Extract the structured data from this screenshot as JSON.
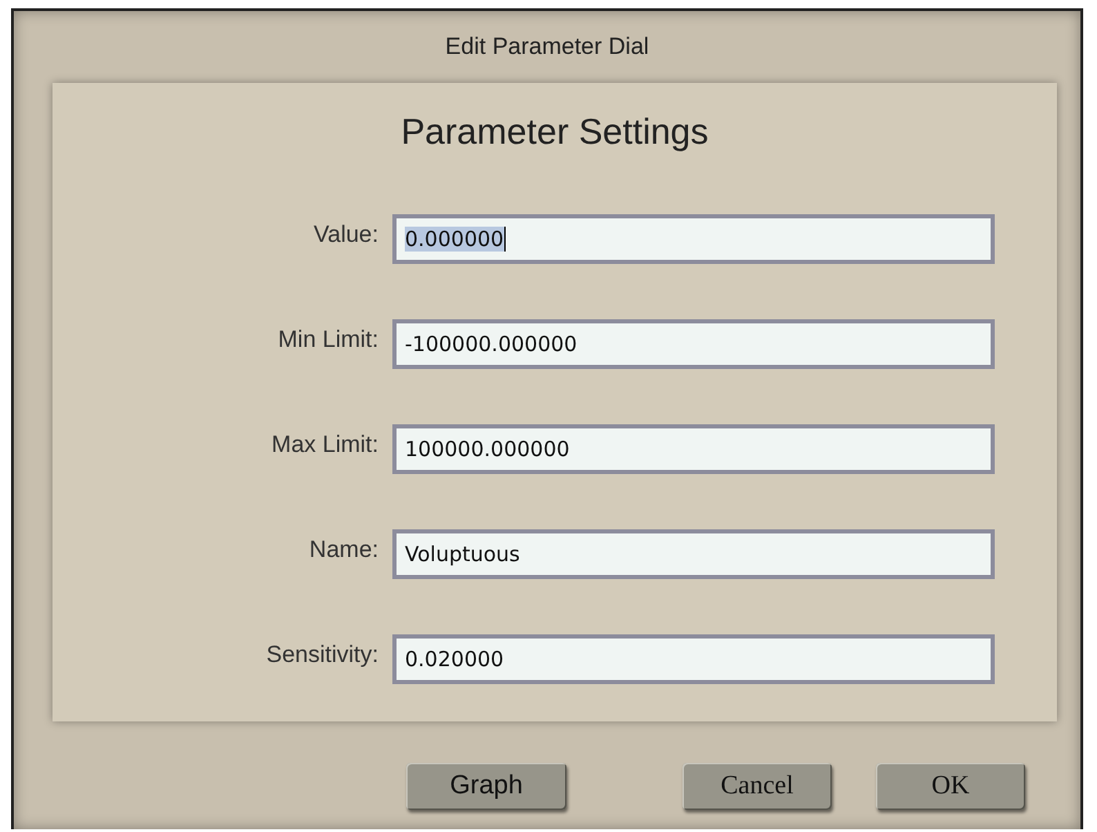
{
  "window": {
    "title": "Edit Parameter Dial"
  },
  "heading": "Parameter Settings",
  "fields": [
    {
      "label": "Value:",
      "value": "0.000000",
      "selected": true
    },
    {
      "label": "Min Limit:",
      "value": "-100000.000000",
      "selected": false
    },
    {
      "label": "Max Limit:",
      "value": "100000.000000",
      "selected": false
    },
    {
      "label": "Name:",
      "value": "Voluptuous",
      "selected": false
    },
    {
      "label": "Sensitivity:",
      "value": "0.020000",
      "selected": false
    }
  ],
  "buttons": [
    {
      "label": "Graph",
      "kind": "tool"
    },
    {
      "label": "Cancel",
      "kind": "dialog"
    },
    {
      "label": "OK",
      "kind": "dialog"
    }
  ]
}
